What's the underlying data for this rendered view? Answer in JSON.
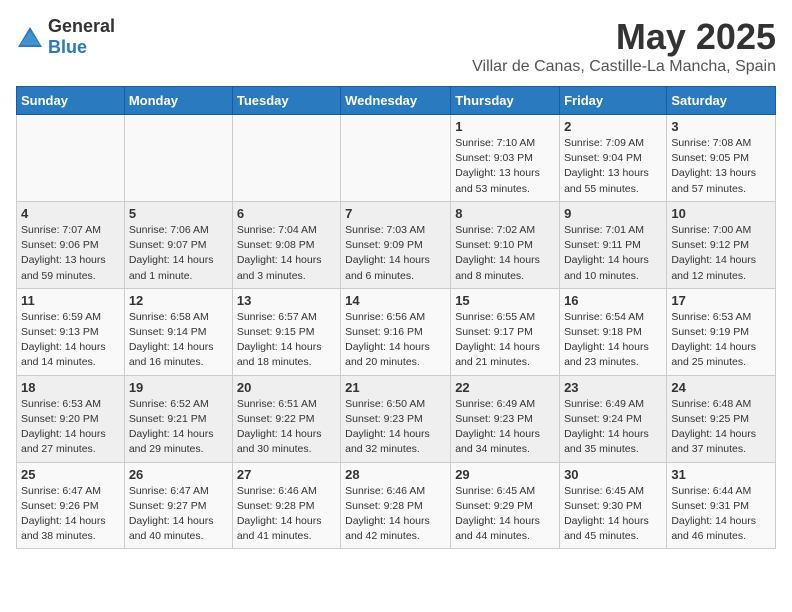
{
  "header": {
    "logo_general": "General",
    "logo_blue": "Blue",
    "month": "May 2025",
    "location": "Villar de Canas, Castille-La Mancha, Spain"
  },
  "weekdays": [
    "Sunday",
    "Monday",
    "Tuesday",
    "Wednesday",
    "Thursday",
    "Friday",
    "Saturday"
  ],
  "weeks": [
    [
      {
        "day": "",
        "info": ""
      },
      {
        "day": "",
        "info": ""
      },
      {
        "day": "",
        "info": ""
      },
      {
        "day": "",
        "info": ""
      },
      {
        "day": "1",
        "info": "Sunrise: 7:10 AM\nSunset: 9:03 PM\nDaylight: 13 hours\nand 53 minutes."
      },
      {
        "day": "2",
        "info": "Sunrise: 7:09 AM\nSunset: 9:04 PM\nDaylight: 13 hours\nand 55 minutes."
      },
      {
        "day": "3",
        "info": "Sunrise: 7:08 AM\nSunset: 9:05 PM\nDaylight: 13 hours\nand 57 minutes."
      }
    ],
    [
      {
        "day": "4",
        "info": "Sunrise: 7:07 AM\nSunset: 9:06 PM\nDaylight: 13 hours\nand 59 minutes."
      },
      {
        "day": "5",
        "info": "Sunrise: 7:06 AM\nSunset: 9:07 PM\nDaylight: 14 hours\nand 1 minute."
      },
      {
        "day": "6",
        "info": "Sunrise: 7:04 AM\nSunset: 9:08 PM\nDaylight: 14 hours\nand 3 minutes."
      },
      {
        "day": "7",
        "info": "Sunrise: 7:03 AM\nSunset: 9:09 PM\nDaylight: 14 hours\nand 6 minutes."
      },
      {
        "day": "8",
        "info": "Sunrise: 7:02 AM\nSunset: 9:10 PM\nDaylight: 14 hours\nand 8 minutes."
      },
      {
        "day": "9",
        "info": "Sunrise: 7:01 AM\nSunset: 9:11 PM\nDaylight: 14 hours\nand 10 minutes."
      },
      {
        "day": "10",
        "info": "Sunrise: 7:00 AM\nSunset: 9:12 PM\nDaylight: 14 hours\nand 12 minutes."
      }
    ],
    [
      {
        "day": "11",
        "info": "Sunrise: 6:59 AM\nSunset: 9:13 PM\nDaylight: 14 hours\nand 14 minutes."
      },
      {
        "day": "12",
        "info": "Sunrise: 6:58 AM\nSunset: 9:14 PM\nDaylight: 14 hours\nand 16 minutes."
      },
      {
        "day": "13",
        "info": "Sunrise: 6:57 AM\nSunset: 9:15 PM\nDaylight: 14 hours\nand 18 minutes."
      },
      {
        "day": "14",
        "info": "Sunrise: 6:56 AM\nSunset: 9:16 PM\nDaylight: 14 hours\nand 20 minutes."
      },
      {
        "day": "15",
        "info": "Sunrise: 6:55 AM\nSunset: 9:17 PM\nDaylight: 14 hours\nand 21 minutes."
      },
      {
        "day": "16",
        "info": "Sunrise: 6:54 AM\nSunset: 9:18 PM\nDaylight: 14 hours\nand 23 minutes."
      },
      {
        "day": "17",
        "info": "Sunrise: 6:53 AM\nSunset: 9:19 PM\nDaylight: 14 hours\nand 25 minutes."
      }
    ],
    [
      {
        "day": "18",
        "info": "Sunrise: 6:53 AM\nSunset: 9:20 PM\nDaylight: 14 hours\nand 27 minutes."
      },
      {
        "day": "19",
        "info": "Sunrise: 6:52 AM\nSunset: 9:21 PM\nDaylight: 14 hours\nand 29 minutes."
      },
      {
        "day": "20",
        "info": "Sunrise: 6:51 AM\nSunset: 9:22 PM\nDaylight: 14 hours\nand 30 minutes."
      },
      {
        "day": "21",
        "info": "Sunrise: 6:50 AM\nSunset: 9:23 PM\nDaylight: 14 hours\nand 32 minutes."
      },
      {
        "day": "22",
        "info": "Sunrise: 6:49 AM\nSunset: 9:23 PM\nDaylight: 14 hours\nand 34 minutes."
      },
      {
        "day": "23",
        "info": "Sunrise: 6:49 AM\nSunset: 9:24 PM\nDaylight: 14 hours\nand 35 minutes."
      },
      {
        "day": "24",
        "info": "Sunrise: 6:48 AM\nSunset: 9:25 PM\nDaylight: 14 hours\nand 37 minutes."
      }
    ],
    [
      {
        "day": "25",
        "info": "Sunrise: 6:47 AM\nSunset: 9:26 PM\nDaylight: 14 hours\nand 38 minutes."
      },
      {
        "day": "26",
        "info": "Sunrise: 6:47 AM\nSunset: 9:27 PM\nDaylight: 14 hours\nand 40 minutes."
      },
      {
        "day": "27",
        "info": "Sunrise: 6:46 AM\nSunset: 9:28 PM\nDaylight: 14 hours\nand 41 minutes."
      },
      {
        "day": "28",
        "info": "Sunrise: 6:46 AM\nSunset: 9:28 PM\nDaylight: 14 hours\nand 42 minutes."
      },
      {
        "day": "29",
        "info": "Sunrise: 6:45 AM\nSunset: 9:29 PM\nDaylight: 14 hours\nand 44 minutes."
      },
      {
        "day": "30",
        "info": "Sunrise: 6:45 AM\nSunset: 9:30 PM\nDaylight: 14 hours\nand 45 minutes."
      },
      {
        "day": "31",
        "info": "Sunrise: 6:44 AM\nSunset: 9:31 PM\nDaylight: 14 hours\nand 46 minutes."
      }
    ]
  ]
}
